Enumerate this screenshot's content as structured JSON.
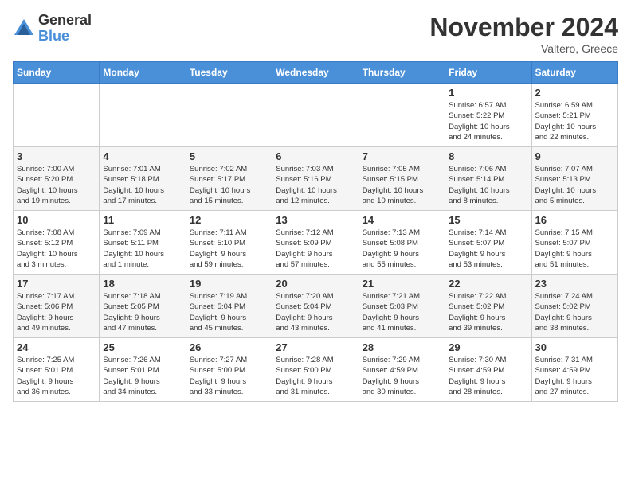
{
  "logo": {
    "general": "General",
    "blue": "Blue"
  },
  "header": {
    "month": "November 2024",
    "location": "Valtero, Greece"
  },
  "weekdays": [
    "Sunday",
    "Monday",
    "Tuesday",
    "Wednesday",
    "Thursday",
    "Friday",
    "Saturday"
  ],
  "weeks": [
    [
      {
        "day": "",
        "info": ""
      },
      {
        "day": "",
        "info": ""
      },
      {
        "day": "",
        "info": ""
      },
      {
        "day": "",
        "info": ""
      },
      {
        "day": "",
        "info": ""
      },
      {
        "day": "1",
        "info": "Sunrise: 6:57 AM\nSunset: 5:22 PM\nDaylight: 10 hours\nand 24 minutes."
      },
      {
        "day": "2",
        "info": "Sunrise: 6:59 AM\nSunset: 5:21 PM\nDaylight: 10 hours\nand 22 minutes."
      }
    ],
    [
      {
        "day": "3",
        "info": "Sunrise: 7:00 AM\nSunset: 5:20 PM\nDaylight: 10 hours\nand 19 minutes."
      },
      {
        "day": "4",
        "info": "Sunrise: 7:01 AM\nSunset: 5:18 PM\nDaylight: 10 hours\nand 17 minutes."
      },
      {
        "day": "5",
        "info": "Sunrise: 7:02 AM\nSunset: 5:17 PM\nDaylight: 10 hours\nand 15 minutes."
      },
      {
        "day": "6",
        "info": "Sunrise: 7:03 AM\nSunset: 5:16 PM\nDaylight: 10 hours\nand 12 minutes."
      },
      {
        "day": "7",
        "info": "Sunrise: 7:05 AM\nSunset: 5:15 PM\nDaylight: 10 hours\nand 10 minutes."
      },
      {
        "day": "8",
        "info": "Sunrise: 7:06 AM\nSunset: 5:14 PM\nDaylight: 10 hours\nand 8 minutes."
      },
      {
        "day": "9",
        "info": "Sunrise: 7:07 AM\nSunset: 5:13 PM\nDaylight: 10 hours\nand 5 minutes."
      }
    ],
    [
      {
        "day": "10",
        "info": "Sunrise: 7:08 AM\nSunset: 5:12 PM\nDaylight: 10 hours\nand 3 minutes."
      },
      {
        "day": "11",
        "info": "Sunrise: 7:09 AM\nSunset: 5:11 PM\nDaylight: 10 hours\nand 1 minute."
      },
      {
        "day": "12",
        "info": "Sunrise: 7:11 AM\nSunset: 5:10 PM\nDaylight: 9 hours\nand 59 minutes."
      },
      {
        "day": "13",
        "info": "Sunrise: 7:12 AM\nSunset: 5:09 PM\nDaylight: 9 hours\nand 57 minutes."
      },
      {
        "day": "14",
        "info": "Sunrise: 7:13 AM\nSunset: 5:08 PM\nDaylight: 9 hours\nand 55 minutes."
      },
      {
        "day": "15",
        "info": "Sunrise: 7:14 AM\nSunset: 5:07 PM\nDaylight: 9 hours\nand 53 minutes."
      },
      {
        "day": "16",
        "info": "Sunrise: 7:15 AM\nSunset: 5:07 PM\nDaylight: 9 hours\nand 51 minutes."
      }
    ],
    [
      {
        "day": "17",
        "info": "Sunrise: 7:17 AM\nSunset: 5:06 PM\nDaylight: 9 hours\nand 49 minutes."
      },
      {
        "day": "18",
        "info": "Sunrise: 7:18 AM\nSunset: 5:05 PM\nDaylight: 9 hours\nand 47 minutes."
      },
      {
        "day": "19",
        "info": "Sunrise: 7:19 AM\nSunset: 5:04 PM\nDaylight: 9 hours\nand 45 minutes."
      },
      {
        "day": "20",
        "info": "Sunrise: 7:20 AM\nSunset: 5:04 PM\nDaylight: 9 hours\nand 43 minutes."
      },
      {
        "day": "21",
        "info": "Sunrise: 7:21 AM\nSunset: 5:03 PM\nDaylight: 9 hours\nand 41 minutes."
      },
      {
        "day": "22",
        "info": "Sunrise: 7:22 AM\nSunset: 5:02 PM\nDaylight: 9 hours\nand 39 minutes."
      },
      {
        "day": "23",
        "info": "Sunrise: 7:24 AM\nSunset: 5:02 PM\nDaylight: 9 hours\nand 38 minutes."
      }
    ],
    [
      {
        "day": "24",
        "info": "Sunrise: 7:25 AM\nSunset: 5:01 PM\nDaylight: 9 hours\nand 36 minutes."
      },
      {
        "day": "25",
        "info": "Sunrise: 7:26 AM\nSunset: 5:01 PM\nDaylight: 9 hours\nand 34 minutes."
      },
      {
        "day": "26",
        "info": "Sunrise: 7:27 AM\nSunset: 5:00 PM\nDaylight: 9 hours\nand 33 minutes."
      },
      {
        "day": "27",
        "info": "Sunrise: 7:28 AM\nSunset: 5:00 PM\nDaylight: 9 hours\nand 31 minutes."
      },
      {
        "day": "28",
        "info": "Sunrise: 7:29 AM\nSunset: 4:59 PM\nDaylight: 9 hours\nand 30 minutes."
      },
      {
        "day": "29",
        "info": "Sunrise: 7:30 AM\nSunset: 4:59 PM\nDaylight: 9 hours\nand 28 minutes."
      },
      {
        "day": "30",
        "info": "Sunrise: 7:31 AM\nSunset: 4:59 PM\nDaylight: 9 hours\nand 27 minutes."
      }
    ]
  ]
}
